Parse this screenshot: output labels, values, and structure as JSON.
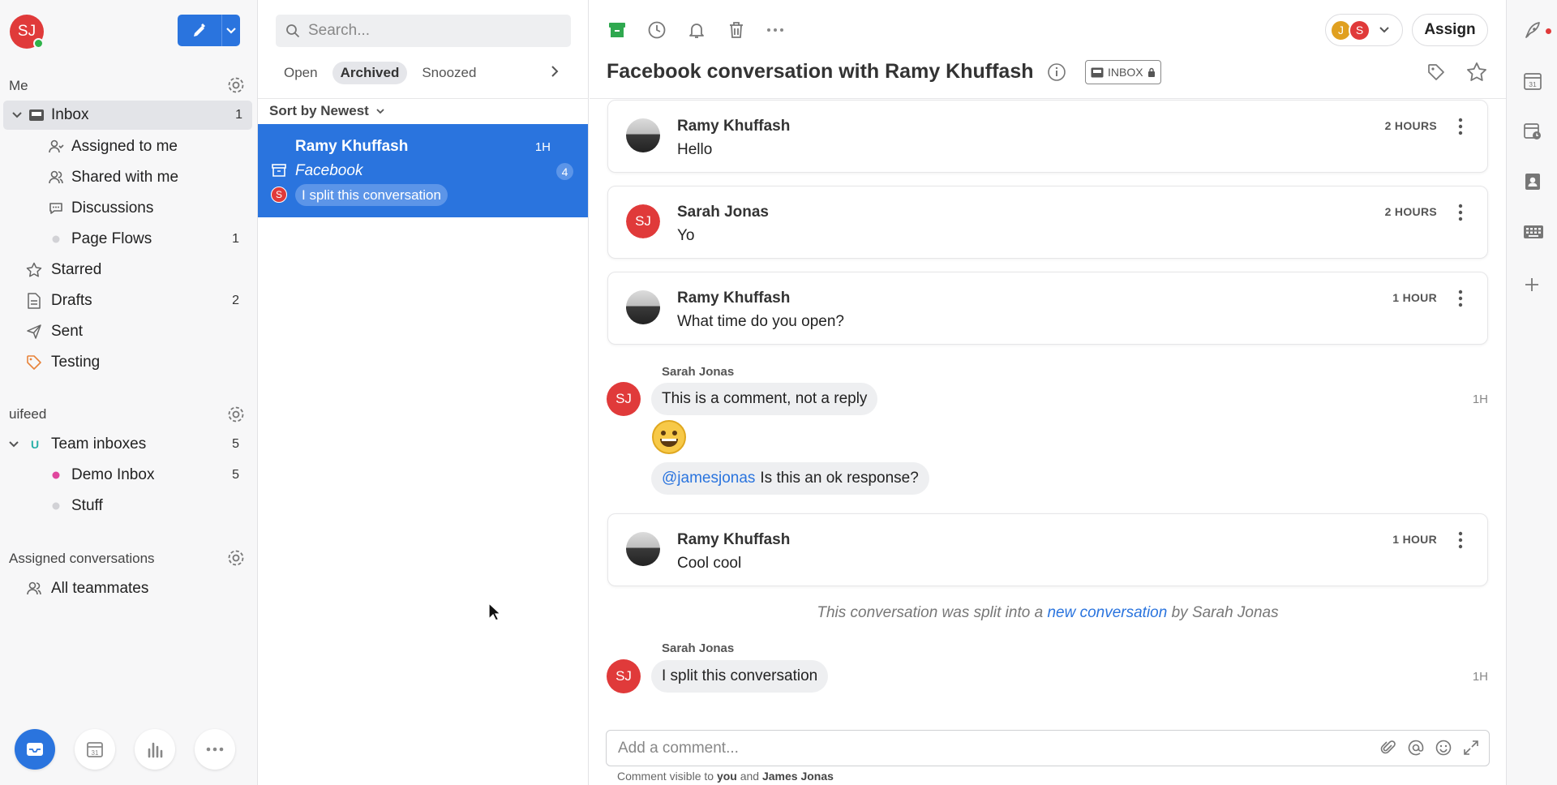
{
  "user": {
    "initials": "SJ",
    "status_color": "#2fb34a"
  },
  "colors": {
    "accent": "#2a74de",
    "avatar_red": "#e03a3a",
    "avatar_yellow": "#e0a020",
    "archive_green": "#2fa84f",
    "team_u": "#2bb0a8",
    "demo_dot": "#e0479e"
  },
  "sidebar": {
    "me_label": "Me",
    "items": [
      {
        "label": "Inbox",
        "count": "1",
        "icon": "inbox-icon"
      },
      {
        "label": "Assigned to me",
        "count": "",
        "icon": "assigned-icon"
      },
      {
        "label": "Shared with me",
        "count": "",
        "icon": "shared-icon"
      },
      {
        "label": "Discussions",
        "count": "",
        "icon": "discussion-icon"
      },
      {
        "label": "Page Flows",
        "count": "1",
        "icon": "dot-icon"
      },
      {
        "label": "Starred",
        "count": "",
        "icon": "star-icon"
      },
      {
        "label": "Drafts",
        "count": "2",
        "icon": "draft-icon"
      },
      {
        "label": "Sent",
        "count": "",
        "icon": "send-icon"
      },
      {
        "label": "Testing",
        "count": "",
        "icon": "tag-icon"
      }
    ],
    "team_section": "uifeed",
    "team_items": [
      {
        "label": "Team inboxes",
        "count": "5",
        "badge": "U"
      },
      {
        "label": "Demo Inbox",
        "count": "5"
      },
      {
        "label": "Stuff",
        "count": ""
      }
    ],
    "assigned_section": "Assigned conversations",
    "assigned_items": [
      {
        "label": "All teammates",
        "icon": "teammates-icon"
      }
    ]
  },
  "list": {
    "search_placeholder": "Search...",
    "tabs": [
      "Open",
      "Archived",
      "Snoozed"
    ],
    "active_tab": "Archived",
    "sort_label": "Sort by Newest",
    "conversation": {
      "name": "Ramy Khuffash",
      "time": "1H",
      "source": "Facebook",
      "badge": "4",
      "avatar": "S",
      "snippet": "I split this conversation"
    }
  },
  "conversation": {
    "title": "Facebook conversation with Ramy Khuffash",
    "inbox_tag": "INBOX",
    "assignees": [
      "J",
      "S"
    ],
    "assign_label": "Assign",
    "messages": [
      {
        "sender": "Ramy Khuffash",
        "body": "Hello",
        "time": "2 HOURS",
        "avatar": "photo"
      },
      {
        "sender": "Sarah Jonas",
        "body": "Yo",
        "time": "2 HOURS",
        "avatar": "SJ"
      },
      {
        "sender": "Ramy Khuffash",
        "body": "What time do you open?",
        "time": "1 HOUR",
        "avatar": "photo"
      }
    ],
    "comment_group1": {
      "author": "Sarah Jonas",
      "avatar": "SJ",
      "time": "1H",
      "comment1": "This is a comment, not a reply",
      "emoji": "grinning-face",
      "mention": "@jamesjonas",
      "comment3": "Is this an ok response?"
    },
    "message4": {
      "sender": "Ramy Khuffash",
      "body": "Cool cool",
      "time": "1 HOUR"
    },
    "split_note": {
      "pre": "This conversation was split into a",
      "link": "new conversation",
      "post": "by Sarah Jonas"
    },
    "comment_group2": {
      "author": "Sarah Jonas",
      "avatar": "SJ",
      "time": "1H",
      "text": "I split this conversation"
    },
    "composer_placeholder": "Add a comment...",
    "visibility": {
      "pre": "Comment visible to",
      "you": "you",
      "and": "and",
      "other": "James Jonas"
    }
  }
}
